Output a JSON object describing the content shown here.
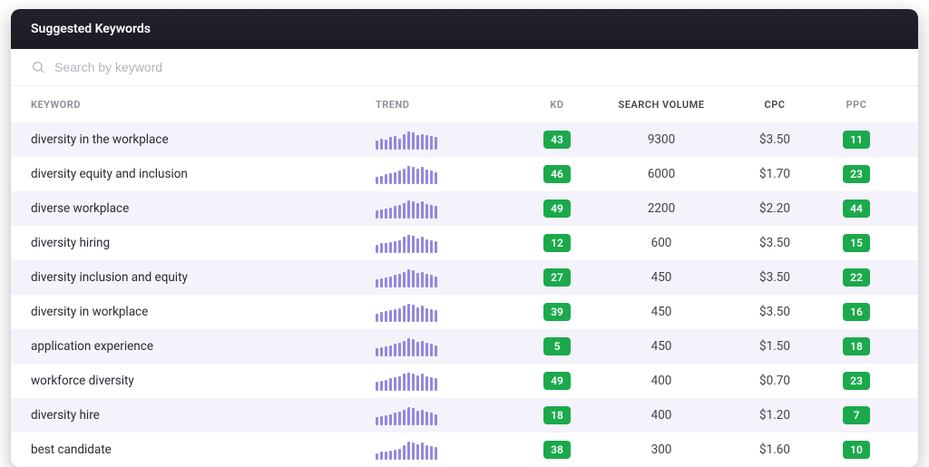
{
  "header": {
    "title": "Suggested Keywords"
  },
  "search": {
    "placeholder": "Search by keyword"
  },
  "columns": {
    "keyword": "KEYWORD",
    "trend": "TREND",
    "kd": "KD",
    "volume": "SEARCH VOLUME",
    "cpc": "CPC",
    "ppc": "PPC"
  },
  "rows": [
    {
      "keyword": "diversity in the workplace",
      "trend": [
        8,
        10,
        9,
        11,
        12,
        10,
        14,
        16,
        15,
        13,
        14,
        13,
        12,
        11
      ],
      "kd": "43",
      "volume": "9300",
      "cpc": "$3.50",
      "ppc": "11"
    },
    {
      "keyword": "diversity equity and inclusion",
      "trend": [
        6,
        7,
        8,
        9,
        10,
        11,
        13,
        15,
        14,
        13,
        14,
        12,
        11,
        10
      ],
      "kd": "46",
      "volume": "6000",
      "cpc": "$1.70",
      "ppc": "23"
    },
    {
      "keyword": "diverse workplace",
      "trend": [
        7,
        8,
        9,
        10,
        11,
        12,
        14,
        16,
        15,
        14,
        15,
        13,
        12,
        11
      ],
      "kd": "49",
      "volume": "2200",
      "cpc": "$2.20",
      "ppc": "44"
    },
    {
      "keyword": "diversity hiring",
      "trend": [
        8,
        9,
        9,
        10,
        11,
        12,
        15,
        17,
        16,
        14,
        15,
        13,
        12,
        11
      ],
      "kd": "12",
      "volume": "600",
      "cpc": "$3.50",
      "ppc": "15"
    },
    {
      "keyword": "diversity inclusion and equity",
      "trend": [
        7,
        8,
        9,
        10,
        11,
        12,
        14,
        16,
        15,
        13,
        14,
        12,
        11,
        10
      ],
      "kd": "27",
      "volume": "450",
      "cpc": "$3.50",
      "ppc": "22"
    },
    {
      "keyword": "diversity in workplace",
      "trend": [
        8,
        9,
        10,
        11,
        12,
        13,
        15,
        17,
        16,
        14,
        15,
        13,
        12,
        11
      ],
      "kd": "39",
      "volume": "450",
      "cpc": "$3.50",
      "ppc": "16"
    },
    {
      "keyword": "application experience",
      "trend": [
        7,
        8,
        9,
        10,
        11,
        12,
        14,
        16,
        15,
        13,
        14,
        12,
        11,
        10
      ],
      "kd": "5",
      "volume": "450",
      "cpc": "$1.50",
      "ppc": "18"
    },
    {
      "keyword": "workforce diversity",
      "trend": [
        8,
        9,
        10,
        11,
        12,
        13,
        15,
        16,
        15,
        14,
        15,
        13,
        12,
        11
      ],
      "kd": "49",
      "volume": "400",
      "cpc": "$0.70",
      "ppc": "23"
    },
    {
      "keyword": "diversity hire",
      "trend": [
        7,
        8,
        9,
        10,
        11,
        12,
        14,
        16,
        15,
        13,
        14,
        12,
        11,
        10
      ],
      "kd": "18",
      "volume": "400",
      "cpc": "$1.20",
      "ppc": "7"
    },
    {
      "keyword": "best candidate",
      "trend": [
        6,
        7,
        7,
        8,
        9,
        10,
        13,
        16,
        15,
        14,
        15,
        13,
        12,
        11
      ],
      "kd": "38",
      "volume": "300",
      "cpc": "$1.60",
      "ppc": "10"
    }
  ],
  "colors": {
    "badge": "#1ba94c",
    "spark": "#8a7bd8"
  }
}
